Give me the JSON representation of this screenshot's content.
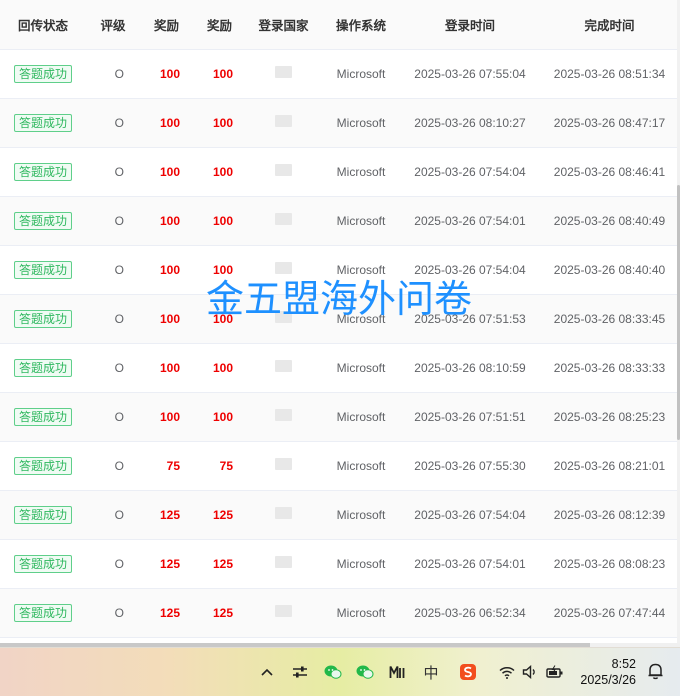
{
  "table": {
    "headers": [
      "回传状态",
      "评级",
      "奖励",
      "奖励",
      "登录国家",
      "操作系统",
      "登录时间",
      "完成时间"
    ],
    "rows": [
      {
        "status": "答题成功",
        "rating": "O",
        "reward1": "100",
        "reward2": "100",
        "os": "Microsoft",
        "login": "2025-03-26 07:55:04",
        "done": "2025-03-26 08:51:34"
      },
      {
        "status": "答题成功",
        "rating": "O",
        "reward1": "100",
        "reward2": "100",
        "os": "Microsoft",
        "login": "2025-03-26 08:10:27",
        "done": "2025-03-26 08:47:17"
      },
      {
        "status": "答题成功",
        "rating": "O",
        "reward1": "100",
        "reward2": "100",
        "os": "Microsoft",
        "login": "2025-03-26 07:54:04",
        "done": "2025-03-26 08:46:41"
      },
      {
        "status": "答题成功",
        "rating": "O",
        "reward1": "100",
        "reward2": "100",
        "os": "Microsoft",
        "login": "2025-03-26 07:54:01",
        "done": "2025-03-26 08:40:49"
      },
      {
        "status": "答题成功",
        "rating": "O",
        "reward1": "100",
        "reward2": "100",
        "os": "Microsoft",
        "login": "2025-03-26 07:54:04",
        "done": "2025-03-26 08:40:40"
      },
      {
        "status": "答题成功",
        "rating": "O",
        "reward1": "100",
        "reward2": "100",
        "os": "Microsoft",
        "login": "2025-03-26 07:51:53",
        "done": "2025-03-26 08:33:45"
      },
      {
        "status": "答题成功",
        "rating": "O",
        "reward1": "100",
        "reward2": "100",
        "os": "Microsoft",
        "login": "2025-03-26 08:10:59",
        "done": "2025-03-26 08:33:33"
      },
      {
        "status": "答题成功",
        "rating": "O",
        "reward1": "100",
        "reward2": "100",
        "os": "Microsoft",
        "login": "2025-03-26 07:51:51",
        "done": "2025-03-26 08:25:23"
      },
      {
        "status": "答题成功",
        "rating": "O",
        "reward1": "75",
        "reward2": "75",
        "os": "Microsoft",
        "login": "2025-03-26 07:55:30",
        "done": "2025-03-26 08:21:01"
      },
      {
        "status": "答题成功",
        "rating": "O",
        "reward1": "125",
        "reward2": "125",
        "os": "Microsoft",
        "login": "2025-03-26 07:54:04",
        "done": "2025-03-26 08:12:39"
      },
      {
        "status": "答题成功",
        "rating": "O",
        "reward1": "125",
        "reward2": "125",
        "os": "Microsoft",
        "login": "2025-03-26 07:54:01",
        "done": "2025-03-26 08:08:23"
      },
      {
        "status": "答题成功",
        "rating": "O",
        "reward1": "125",
        "reward2": "125",
        "os": "Microsoft",
        "login": "2025-03-26 06:52:34",
        "done": "2025-03-26 07:47:44"
      }
    ]
  },
  "watermark": "金五盟海外问卷",
  "taskbar": {
    "tray_icons": [
      "chevron-up-icon",
      "sliders-icon",
      "wechat-icon",
      "wechat-alt-icon",
      "m-app-icon",
      "ime-chinese-icon",
      "sogou-icon",
      "wifi-icon",
      "volume-icon",
      "battery-icon"
    ],
    "ime_label": "中",
    "time": "8:52",
    "date": "2025/3/26"
  },
  "colors": {
    "accent_red": "#ee0000",
    "tag_green": "#2fb85f",
    "watermark_blue": "#1e90ff"
  }
}
